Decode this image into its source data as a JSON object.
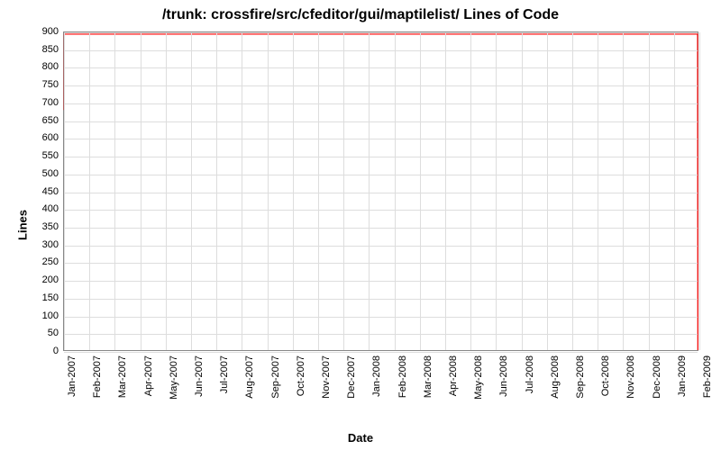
{
  "chart_data": {
    "type": "line",
    "title": "/trunk: crossfire/src/cfeditor/gui/maptilelist/ Lines of Code",
    "xlabel": "Date",
    "ylabel": "Lines",
    "ylim": [
      0,
      900
    ],
    "yticks": [
      0,
      50,
      100,
      150,
      200,
      250,
      300,
      350,
      400,
      450,
      500,
      550,
      600,
      650,
      700,
      750,
      800,
      850,
      900
    ],
    "categories": [
      "Jan-2007",
      "Feb-2007",
      "Mar-2007",
      "Apr-2007",
      "May-2007",
      "Jun-2007",
      "Jul-2007",
      "Aug-2007",
      "Sep-2007",
      "Oct-2007",
      "Nov-2007",
      "Dec-2007",
      "Jan-2008",
      "Feb-2008",
      "Mar-2008",
      "Apr-2008",
      "May-2008",
      "Jun-2008",
      "Jul-2008",
      "Aug-2008",
      "Sep-2008",
      "Oct-2008",
      "Nov-2008",
      "Dec-2008",
      "Jan-2009",
      "Feb-2009"
    ],
    "series": [
      {
        "name": "lines-of-code",
        "color": "#ff0000",
        "points": [
          {
            "x": 0.01,
            "y": 680
          },
          {
            "x": 0.015,
            "y": 895
          },
          {
            "x": 25.0,
            "y": 895
          },
          {
            "x": 25.01,
            "y": 0
          }
        ]
      }
    ]
  }
}
